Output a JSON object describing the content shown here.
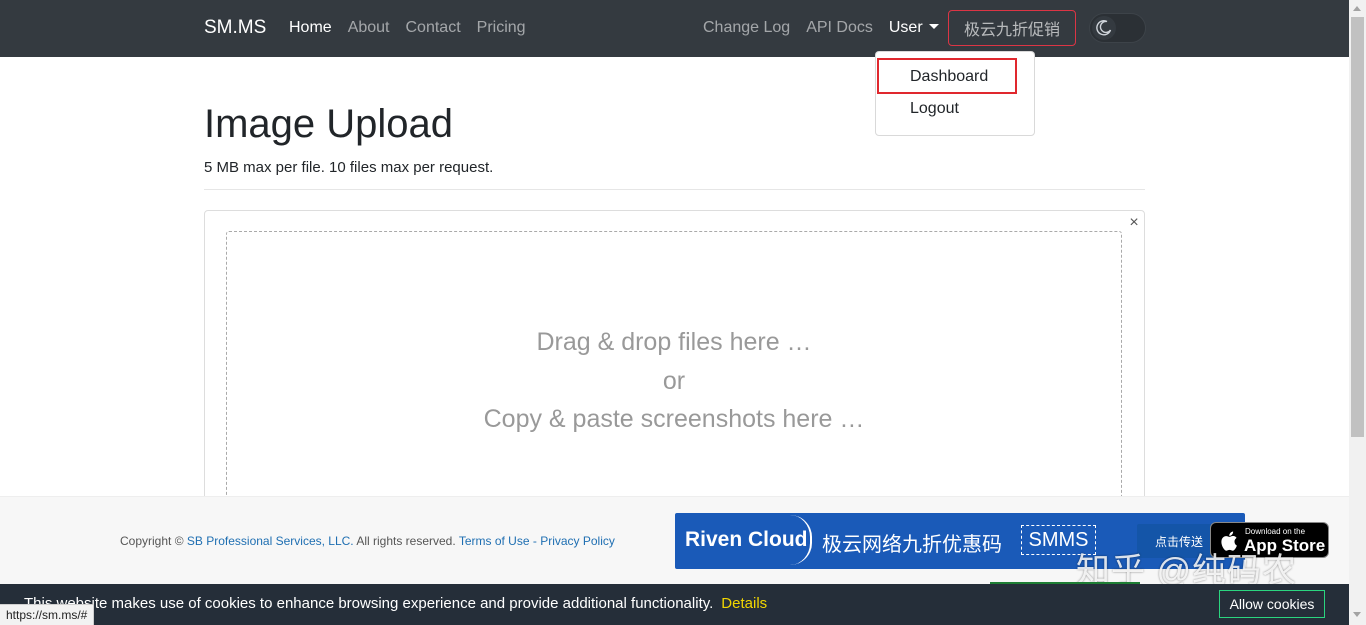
{
  "navbar": {
    "brand": "SM.MS",
    "left_links": [
      "Home",
      "About",
      "Contact",
      "Pricing"
    ],
    "right_links": [
      "Change Log",
      "API Docs"
    ],
    "user_menu": "User",
    "promo_button": "极云九折促销",
    "theme_toggle_icon": "moon-icon"
  },
  "user_dropdown": {
    "items": [
      "Dashboard",
      "Logout"
    ],
    "highlight_color": "#e0282e"
  },
  "main": {
    "title": "Image Upload",
    "subtitle": "5 MB max per file. 10 files max per request.",
    "close_symbol": "×",
    "dropzone": {
      "line1": "Drag & drop files here …",
      "line2": "or",
      "line3": "Copy & paste screenshots here …"
    }
  },
  "footer": {
    "copyright_prefix": "Copyright",
    "copyright_company": "SB Professional Services, LLC.",
    "copyright_rights": "All rights reserved.",
    "terms": "Terms of Use",
    "separator": "-",
    "privacy": "Privacy Policy",
    "ad": {
      "brand": "Riven Cloud",
      "text": "极云网络九折优惠码",
      "code": "SMMS",
      "send": "点击传送",
      "color": "#1a5ab8"
    },
    "app_store": {
      "small": "Download on the",
      "big": "App Store"
    },
    "watermark": "知乎 @纯码农"
  },
  "cookie_bar": {
    "message": "This website makes use of cookies to enhance browsing experience and provide additional functionality.",
    "details": "Details",
    "allow": "Allow cookies"
  },
  "status_url": "https://sm.ms/#",
  "colors": {
    "navbar_bg": "#343a40",
    "accent_red": "#dc3545",
    "link_blue": "#1f6fb2",
    "cookie_bg": "#252e39",
    "cookie_link": "#f1d600"
  }
}
